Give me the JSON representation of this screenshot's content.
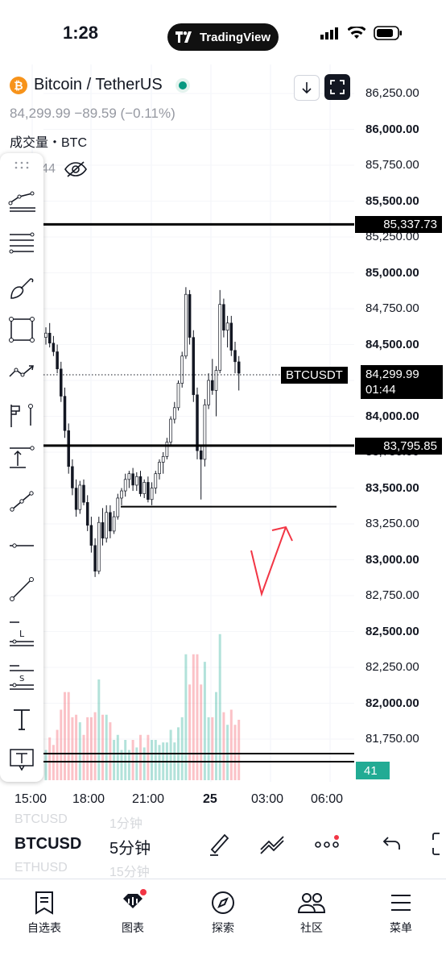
{
  "status": {
    "time": "1:28",
    "app_brand": "TradingView"
  },
  "symbol": {
    "icon_letter": "₿",
    "title": "Bitcoin / TetherUS",
    "price_line": "84,299.99  −89.59 (−0.11%)",
    "volume_label": "成交量・BTC",
    "volume_value": "12 144"
  },
  "chart_buttons": {
    "down_icon": "arrow-down-icon",
    "fullscreen_icon": "fullscreen-icon"
  },
  "price_axis": [
    "86,250.00",
    "86,000.00",
    "85,750.00",
    "85,500.00",
    "85,250.00",
    "85,000.00",
    "84,750.00",
    "84,500.00",
    "84,250.00",
    "84,000.00",
    "83,750.00",
    "83,500.00",
    "83,250.00",
    "83,000.00",
    "82,750.00",
    "82,500.00",
    "82,250.00",
    "82,000.00",
    "81,750.00"
  ],
  "tags": {
    "level_high": "85,337.73",
    "symbol_tag": "BTCUSDT",
    "current_price": "84,299.99",
    "countdown": "01:44",
    "level_low": "83,795.85",
    "volume_tag": "41"
  },
  "time_axis": [
    "15:00",
    "18:00",
    "21:00",
    "25",
    "03:00",
    "06:00"
  ],
  "bottom_bar": {
    "symbol": "BTCUSD",
    "interval": "5分钟",
    "ghost_above_symbol": "BTCUSD",
    "ghost_above_interval": "1分钟",
    "ghost_below_symbol": "ETHUSD",
    "ghost_below_interval": "15分钟"
  },
  "nav": [
    {
      "label": "自选表",
      "icon": "watchlist-icon"
    },
    {
      "label": "图表",
      "icon": "chart-icon"
    },
    {
      "label": "探索",
      "icon": "compass-icon"
    },
    {
      "label": "社区",
      "icon": "community-icon"
    },
    {
      "label": "菜单",
      "icon": "menu-icon"
    }
  ],
  "colors": {
    "up": "#089981",
    "accent_red": "#f23645",
    "brand_orange": "#f7931a",
    "volume_green": "#22ab94"
  },
  "chart_data": {
    "type": "candlestick",
    "symbol": "BTCUSDT",
    "interval": "5分钟",
    "x": [
      "15:00",
      "18:00",
      "21:00",
      "25",
      "03:00",
      "06:00"
    ],
    "ylim": [
      81650,
      86350
    ],
    "horizontal_lines": [
      85337.73,
      83795.85,
      83370
    ],
    "current_price": 84299.99,
    "candles": [
      [
        84550,
        84620,
        84500,
        84580
      ],
      [
        84580,
        84650,
        84480,
        84510
      ],
      [
        84510,
        84560,
        84420,
        84450
      ],
      [
        84450,
        84500,
        84300,
        84330
      ],
      [
        84330,
        84380,
        84100,
        84140
      ],
      [
        84140,
        84200,
        83850,
        83900
      ],
      [
        83900,
        83950,
        83600,
        83650
      ],
      [
        83650,
        83700,
        83450,
        83500
      ],
      [
        83500,
        83560,
        83300,
        83350
      ],
      [
        83350,
        83550,
        83320,
        83520
      ],
      [
        83520,
        83560,
        83380,
        83400
      ],
      [
        83400,
        83450,
        83200,
        83240
      ],
      [
        83240,
        83300,
        83050,
        83100
      ],
      [
        83100,
        83150,
        82880,
        82920
      ],
      [
        82920,
        83300,
        82900,
        83260
      ],
      [
        83260,
        83360,
        83100,
        83150
      ],
      [
        83150,
        83380,
        83120,
        83330
      ],
      [
        83330,
        83380,
        83150,
        83200
      ],
      [
        83200,
        83340,
        83180,
        83300
      ],
      [
        83300,
        83460,
        83280,
        83430
      ],
      [
        83430,
        83500,
        83380,
        83480
      ],
      [
        83480,
        83600,
        83440,
        83560
      ],
      [
        83560,
        83620,
        83500,
        83600
      ],
      [
        83600,
        83640,
        83480,
        83520
      ],
      [
        83520,
        83610,
        83480,
        83580
      ],
      [
        83580,
        83620,
        83440,
        83460
      ],
      [
        83460,
        83560,
        83430,
        83540
      ],
      [
        83540,
        83580,
        83400,
        83420
      ],
      [
        83420,
        83540,
        83380,
        83500
      ],
      [
        83500,
        83620,
        83460,
        83600
      ],
      [
        83600,
        83700,
        83560,
        83680
      ],
      [
        83680,
        83750,
        83600,
        83720
      ],
      [
        83720,
        83850,
        83700,
        83820
      ],
      [
        83820,
        84000,
        83800,
        83980
      ],
      [
        83980,
        84100,
        83950,
        84060
      ],
      [
        84060,
        84250,
        84040,
        84230
      ],
      [
        84230,
        84450,
        84200,
        84420
      ],
      [
        84420,
        84900,
        84400,
        84850
      ],
      [
        84850,
        84880,
        84500,
        84550
      ],
      [
        84550,
        84600,
        84100,
        84150
      ],
      [
        84150,
        84200,
        83700,
        83760
      ],
      [
        83760,
        83800,
        83420,
        83700
      ],
      [
        83700,
        84120,
        83650,
        84080
      ],
      [
        84080,
        84300,
        84050,
        84250
      ],
      [
        84250,
        84400,
        84150,
        84180
      ],
      [
        84180,
        84350,
        84000,
        84320
      ],
      [
        84320,
        84880,
        84300,
        84780
      ],
      [
        84780,
        84820,
        84550,
        84600
      ],
      [
        84600,
        84700,
        84480,
        84650
      ],
      [
        84650,
        84700,
        84420,
        84460
      ],
      [
        84460,
        84520,
        84300,
        84380
      ],
      [
        84380,
        84420,
        84180,
        84299.99
      ]
    ]
  }
}
